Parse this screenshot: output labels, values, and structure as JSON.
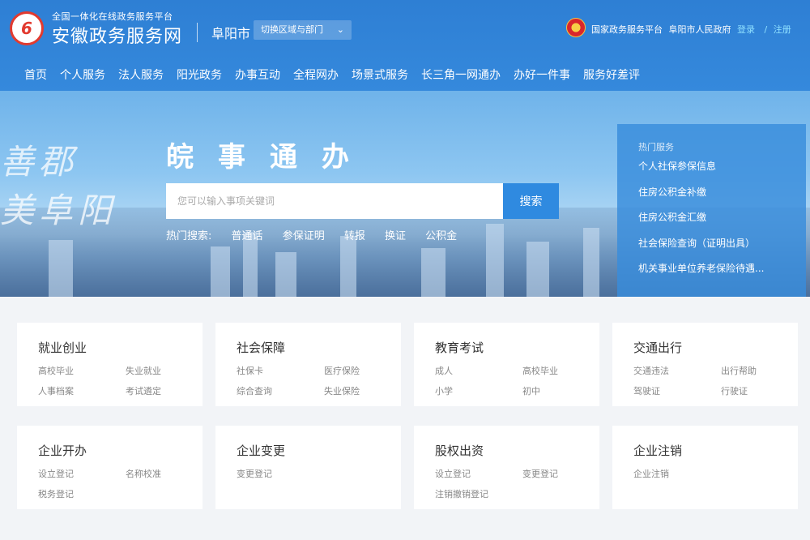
{
  "header": {
    "logo_glyph": "6",
    "logo_subtitle": "全国一体化在线政务服务平台",
    "logo_title": "安徽政务服务网",
    "city": "阜阳市",
    "switch_label": "切换区域与部门",
    "top_links": [
      "国家政务服务平台",
      "阜阳市人民政府"
    ],
    "login": "登录",
    "slash": "/",
    "register": "注册"
  },
  "nav": [
    "首页",
    "个人服务",
    "法人服务",
    "阳光政务",
    "办事互动",
    "全程网办",
    "场景式服务",
    "长三角一网通办",
    "办好一件事",
    "服务好差评"
  ],
  "banner": {
    "slogan_line1": "善郡",
    "slogan_line2": "美阜阳",
    "title": "皖事通办",
    "search_placeholder": "您可以输入事项关键词",
    "search_button": "搜索",
    "hot_label": "热门搜索:",
    "hot_keywords": [
      "普通话",
      "参保证明",
      "转报",
      "换证",
      "公积金"
    ]
  },
  "hot_services": {
    "title": "热门服务",
    "items": [
      "个人社保参保信息",
      "住房公积金补缴",
      "住房公积金汇缴",
      "社会保险查询（证明出具）",
      "机关事业单位养老保险待遇..."
    ]
  },
  "cards": [
    {
      "title": "就业创业",
      "links": [
        "高校毕业",
        "失业就业",
        "人事档案",
        "考试遴定"
      ]
    },
    {
      "title": "社会保障",
      "links": [
        "社保卡",
        "医疗保险",
        "综合查询",
        "失业保险"
      ]
    },
    {
      "title": "教育考试",
      "links": [
        "成人",
        "高校毕业",
        "小学",
        "初中"
      ]
    },
    {
      "title": "交通出行",
      "links": [
        "交通违法",
        "出行帮助",
        "驾驶证",
        "行驶证"
      ]
    },
    {
      "title": "企业开办",
      "links": [
        "设立登记",
        "名称校准",
        "税务登记"
      ]
    },
    {
      "title": "企业变更",
      "links": [
        "变更登记"
      ]
    },
    {
      "title": "股权出资",
      "links": [
        "设立登记",
        "变更登记",
        "注销撤销登记"
      ]
    },
    {
      "title": "企业注销",
      "links": [
        "企业注销"
      ]
    }
  ],
  "colors": {
    "header_blue": "#2e7fd4",
    "search_button": "#2f8ae0",
    "logo_red": "#e23a2f"
  }
}
